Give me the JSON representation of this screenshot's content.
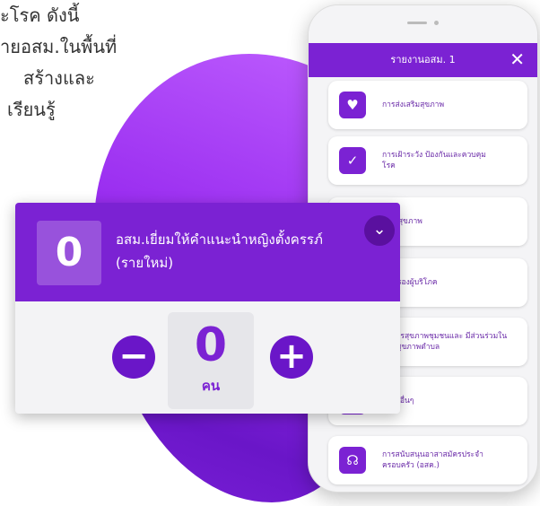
{
  "background_text": {
    "lines": [
      "ะโรค ดังนี้",
      "ายอสม.ในพื้นที่",
      "สร้างและ",
      "เรียนรู้"
    ]
  },
  "phone": {
    "header_title": "รายงานอสม. 1",
    "close_glyph": "✕",
    "menu_items": [
      {
        "label": "การส่งเสริมสุขภาพ",
        "icon": "heart-hand-icon"
      },
      {
        "label": "การเฝ้าระวัง ป้องกันและควบคุมโรค",
        "icon": "shield-check-icon"
      },
      {
        "label": "ฟื้นฟูสุขภาพ",
        "icon": "rehab-icon"
      },
      {
        "label": "คุ้มครองผู้บริโภค",
        "icon": "consumer-icon"
      },
      {
        "label": "จัดการสุขภาพชุมชนและ มีส่วนร่วมในแผนสุขภาพตำบล",
        "icon": "community-icon"
      },
      {
        "label": "กรรมอื่นๆ",
        "icon": "other-icon"
      },
      {
        "label": "การสนับสนุนอาสาสมัครประจำ ครอบครัว (อสค.)",
        "icon": "headset-icon"
      }
    ]
  },
  "card": {
    "count": "0",
    "title": "อสม.เยี่ยมให้คำแนะนำหญิงตั้งครรภ์ (รายใหม่)",
    "chevron_glyph": "⌄",
    "minus_glyph": "−",
    "plus_glyph": "+",
    "value": "0",
    "unit": "คน"
  },
  "colors": {
    "accent": "#7b22d3",
    "accent_dark": "#5a109f",
    "blob_light": "#c060ff"
  }
}
